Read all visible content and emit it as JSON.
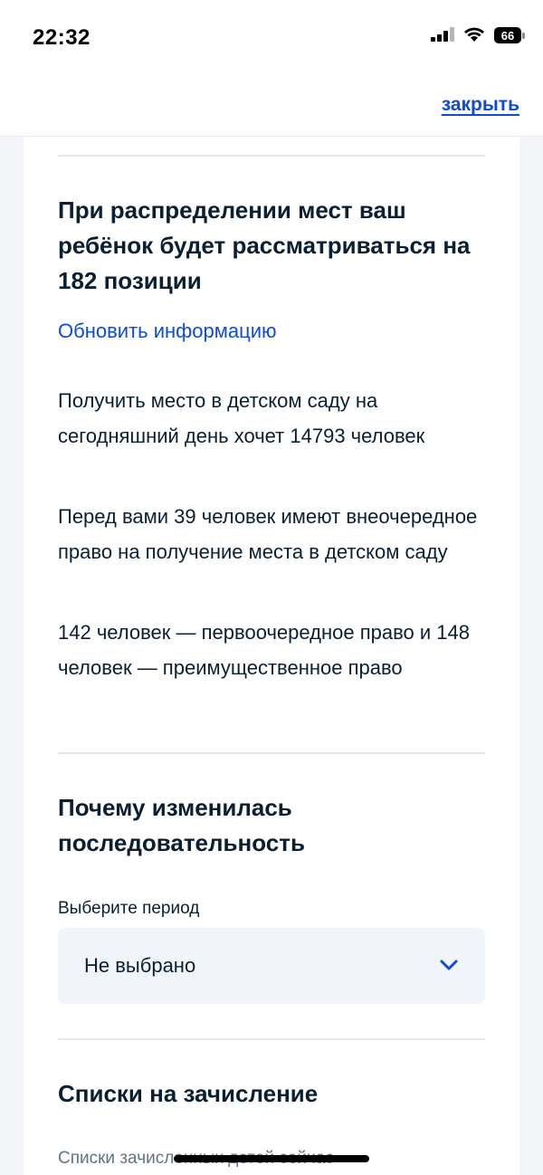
{
  "status_bar": {
    "time": "22:32",
    "battery": "66",
    "icons": [
      "cellular-signal-icon",
      "wifi-icon",
      "battery-icon"
    ]
  },
  "header": {
    "close_label": "закрыть"
  },
  "queue": {
    "position_heading": "При распределении мест ваш ребёнок будет рассматриваться на 182 позиции",
    "update_link": "Обновить информацию",
    "total_text": "Получить место в детском саду на сегодняшний день хочет 14793 человек",
    "priority_text": "Перед вами 39 человек имеют внеочередное право на получение места в детском саду",
    "rights_text": "142 человек — первоочередное право и 148 человек — преимущественное право"
  },
  "sequence": {
    "heading": "Почему изменилась последовательность",
    "period_label": "Выберите период",
    "period_value": "Не выбрано"
  },
  "enrollment": {
    "heading": "Списки на зачисление",
    "subtitle": "Списки зачисленных детей сейчас"
  },
  "colors": {
    "link": "#0d4cd3",
    "text": "#0b1f33",
    "muted": "#66727f",
    "background": "#f3f5f9",
    "select_bg": "#f1f4f8"
  }
}
